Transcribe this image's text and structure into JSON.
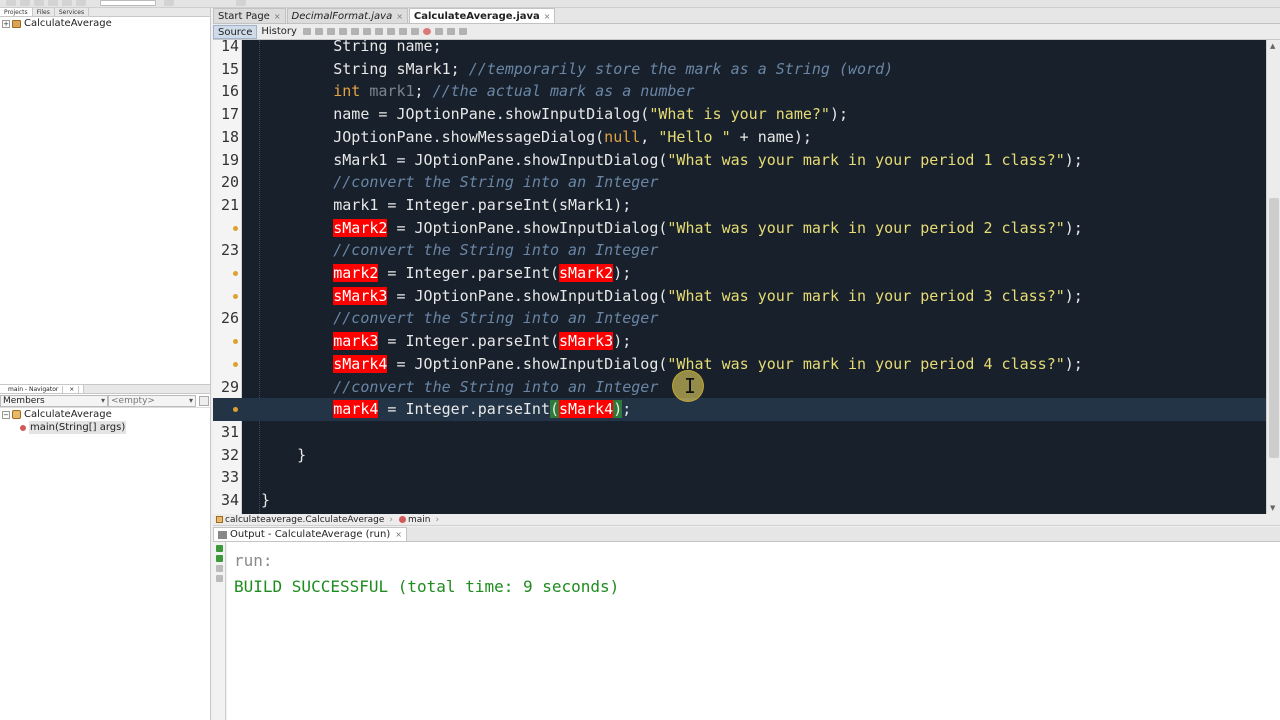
{
  "projects_pane": {
    "tabs": [
      "Projects",
      "Files",
      "Services"
    ],
    "project_name": "CalculateAverage"
  },
  "navigator_pane": {
    "tab": "main - Navigator",
    "filter_selected": "Members",
    "filter_empty": "<empty>",
    "class_name": "CalculateAverage",
    "method": "main(String[] args)"
  },
  "editor_tabs": [
    {
      "label": "Start Page",
      "active": false,
      "italic": false
    },
    {
      "label": "DecimalFormat.java",
      "active": false,
      "italic": true
    },
    {
      "label": "CalculateAverage.java",
      "active": true,
      "italic": false
    }
  ],
  "editor_toolbar": {
    "source_label": "Source",
    "history_label": "History"
  },
  "code_lines": [
    {
      "num": "14",
      "warn": false,
      "current": false,
      "tokens": [
        {
          "t": "        String name;",
          "c": ""
        }
      ]
    },
    {
      "num": "15",
      "warn": false,
      "current": false,
      "tokens": [
        {
          "t": "        String sMark1; ",
          "c": ""
        },
        {
          "t": "//temporarily store the mark as a String (word)",
          "c": "cmt"
        }
      ]
    },
    {
      "num": "16",
      "warn": false,
      "current": false,
      "tokens": [
        {
          "t": "        ",
          "c": ""
        },
        {
          "t": "int",
          "c": "kw"
        },
        {
          "t": " ",
          "c": ""
        },
        {
          "t": "mark1",
          "c": "dim"
        },
        {
          "t": "; ",
          "c": ""
        },
        {
          "t": "//the actual mark as a number",
          "c": "cmt"
        }
      ]
    },
    {
      "num": "17",
      "warn": false,
      "current": false,
      "tokens": [
        {
          "t": "        name = JOptionPane.showInputDialog(",
          "c": ""
        },
        {
          "t": "\"What is your name?\"",
          "c": "str"
        },
        {
          "t": ");",
          "c": ""
        }
      ]
    },
    {
      "num": "18",
      "warn": false,
      "current": false,
      "tokens": [
        {
          "t": "        JOptionPane.showMessageDialog(",
          "c": ""
        },
        {
          "t": "null",
          "c": "kw"
        },
        {
          "t": ", ",
          "c": ""
        },
        {
          "t": "\"Hello \"",
          "c": "str"
        },
        {
          "t": " + name);",
          "c": ""
        }
      ]
    },
    {
      "num": "19",
      "warn": false,
      "current": false,
      "tokens": [
        {
          "t": "        sMark1 = JOptionPane.showInputDialog(",
          "c": ""
        },
        {
          "t": "\"What was your mark in your period 1 class?\"",
          "c": "str"
        },
        {
          "t": ");",
          "c": ""
        }
      ]
    },
    {
      "num": "20",
      "warn": false,
      "current": false,
      "tokens": [
        {
          "t": "        ",
          "c": ""
        },
        {
          "t": "//convert the String into an Integer",
          "c": "cmt"
        }
      ]
    },
    {
      "num": "21",
      "warn": false,
      "current": false,
      "tokens": [
        {
          "t": "        mark1 = Integer.parseInt(sMark1);",
          "c": ""
        }
      ]
    },
    {
      "num": "",
      "warn": true,
      "current": false,
      "tokens": [
        {
          "t": "        ",
          "c": ""
        },
        {
          "t": "sMark2",
          "c": "err"
        },
        {
          "t": " = JOptionPane.showInputDialog(",
          "c": ""
        },
        {
          "t": "\"What was your mark in your period 2 class?\"",
          "c": "str"
        },
        {
          "t": ");",
          "c": ""
        }
      ]
    },
    {
      "num": "23",
      "warn": false,
      "current": false,
      "tokens": [
        {
          "t": "        ",
          "c": ""
        },
        {
          "t": "//convert the String into an Integer",
          "c": "cmt"
        }
      ]
    },
    {
      "num": "",
      "warn": true,
      "current": false,
      "tokens": [
        {
          "t": "        ",
          "c": ""
        },
        {
          "t": "mark2",
          "c": "err"
        },
        {
          "t": " = Integer.parseInt(",
          "c": ""
        },
        {
          "t": "sMark2",
          "c": "err"
        },
        {
          "t": ");",
          "c": ""
        }
      ]
    },
    {
      "num": "",
      "warn": true,
      "current": false,
      "tokens": [
        {
          "t": "        ",
          "c": ""
        },
        {
          "t": "sMark3",
          "c": "err"
        },
        {
          "t": " = JOptionPane.showInputDialog(",
          "c": ""
        },
        {
          "t": "\"What was your mark in your period 3 class?\"",
          "c": "str"
        },
        {
          "t": ");",
          "c": ""
        }
      ]
    },
    {
      "num": "26",
      "warn": false,
      "current": false,
      "tokens": [
        {
          "t": "        ",
          "c": ""
        },
        {
          "t": "//convert the String into an Integer",
          "c": "cmt"
        }
      ]
    },
    {
      "num": "",
      "warn": true,
      "current": false,
      "tokens": [
        {
          "t": "        ",
          "c": ""
        },
        {
          "t": "mark3",
          "c": "err"
        },
        {
          "t": " = Integer.parseInt(",
          "c": ""
        },
        {
          "t": "sMark3",
          "c": "err"
        },
        {
          "t": ");",
          "c": ""
        }
      ]
    },
    {
      "num": "",
      "warn": true,
      "current": false,
      "tokens": [
        {
          "t": "        ",
          "c": ""
        },
        {
          "t": "sMark4",
          "c": "err"
        },
        {
          "t": " = JOptionPane.showInputDialog(",
          "c": ""
        },
        {
          "t": "\"What was your mark in your period 4 class?\"",
          "c": "str"
        },
        {
          "t": ");",
          "c": ""
        }
      ]
    },
    {
      "num": "29",
      "warn": false,
      "current": false,
      "tokens": [
        {
          "t": "        ",
          "c": ""
        },
        {
          "t": "//convert the String into an Integer",
          "c": "cmt"
        }
      ]
    },
    {
      "num": "",
      "warn": true,
      "current": true,
      "tokens": [
        {
          "t": "        ",
          "c": ""
        },
        {
          "t": "mark4",
          "c": "err"
        },
        {
          "t": " = Integer.parseInt",
          "c": ""
        },
        {
          "t": "(",
          "c": "brk"
        },
        {
          "t": "sMark4",
          "c": "err"
        },
        {
          "t": ")",
          "c": "brk"
        },
        {
          "t": ";",
          "c": ""
        }
      ]
    },
    {
      "num": "31",
      "warn": false,
      "current": false,
      "tokens": [
        {
          "t": "",
          "c": ""
        }
      ]
    },
    {
      "num": "32",
      "warn": false,
      "current": false,
      "tokens": [
        {
          "t": "    }",
          "c": ""
        }
      ]
    },
    {
      "num": "33",
      "warn": false,
      "current": false,
      "tokens": [
        {
          "t": "",
          "c": ""
        }
      ]
    },
    {
      "num": "34",
      "warn": false,
      "current": false,
      "tokens": [
        {
          "t": "}",
          "c": ""
        }
      ]
    }
  ],
  "breadcrumb": [
    "calculateaverage.CalculateAverage",
    "main"
  ],
  "output": {
    "tab_label": "Output - CalculateAverage (run)",
    "run_line": "run:",
    "result_line": "BUILD SUCCESSFUL (total time: 9 seconds)"
  },
  "colors": {
    "editor_bg": "#17202b",
    "error_highlight": "#ff0000",
    "string": "#e6db74",
    "comment": "#6b86a5",
    "keyword": "#e5a343",
    "build_success": "#1e8c1e"
  }
}
